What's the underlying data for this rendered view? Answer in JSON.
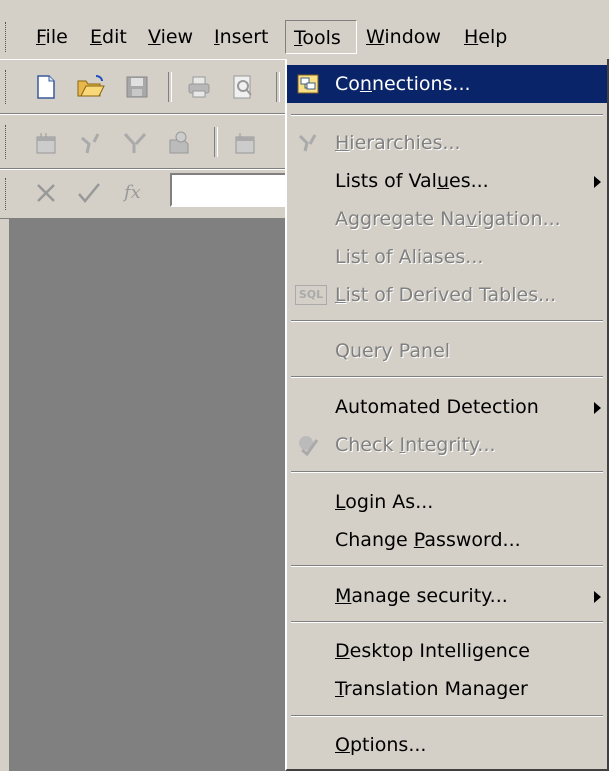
{
  "menubar": {
    "items": [
      {
        "label": "File",
        "key": "F",
        "rest": "ile"
      },
      {
        "label": "Edit",
        "key": "E",
        "rest": "dit"
      },
      {
        "label": "View",
        "key": "V",
        "rest": "iew"
      },
      {
        "label": "Insert",
        "key": "I",
        "rest": "nsert"
      },
      {
        "label": "Tools",
        "key": "T",
        "rest": "ools"
      },
      {
        "label": "Window",
        "key": "W",
        "rest": "indow"
      },
      {
        "label": "Help",
        "key": "H",
        "rest": "elp"
      }
    ]
  },
  "formula_bar": {
    "fx_label": "fx",
    "value": ""
  },
  "tools_menu": {
    "items": [
      {
        "label": "Connections...",
        "pre": "Co",
        "key": "n",
        "post": "nections...",
        "state": "highlighted",
        "icon": "connections-icon"
      },
      {
        "label": "Hierarchies...",
        "pre": "",
        "key": "H",
        "post": "ierarchies...",
        "state": "disabled",
        "icon": "hierarchies-icon"
      },
      {
        "label": "Lists of Values...",
        "pre": "Lists of Val",
        "key": "u",
        "post": "es...",
        "state": "enabled",
        "submenu": true
      },
      {
        "label": "Aggregate Navigation...",
        "pre": "Aggregate Na",
        "key": "v",
        "post": "igation...",
        "state": "disabled"
      },
      {
        "label": "List of Aliases...",
        "pre": "List of Aliases...",
        "key": "",
        "post": "",
        "state": "disabled"
      },
      {
        "label": "List of Derived Tables...",
        "pre": "",
        "key": "L",
        "post": "ist of Derived Tables...",
        "state": "disabled",
        "icon": "sql-icon",
        "icon_text": "SQL"
      },
      {
        "label": "Query Panel",
        "pre": "Query Panel",
        "key": "",
        "post": "",
        "state": "disabled"
      },
      {
        "label": "Automated Detection",
        "pre": "Automated Detection",
        "key": "",
        "post": "",
        "state": "enabled",
        "submenu": true
      },
      {
        "label": "Check Integrity...",
        "pre": "Check ",
        "key": "I",
        "post": "ntegrity...",
        "state": "disabled",
        "icon": "check-integrity-icon"
      },
      {
        "label": "Login As...",
        "pre": "",
        "key": "L",
        "post": "ogin As...",
        "state": "enabled"
      },
      {
        "label": "Change Password...",
        "pre": "Change ",
        "key": "P",
        "post": "assword...",
        "state": "enabled"
      },
      {
        "label": "Manage security...",
        "pre": "",
        "key": "M",
        "post": "anage security...",
        "state": "enabled",
        "submenu": true
      },
      {
        "label": "Desktop Intelligence",
        "pre": "",
        "key": "D",
        "post": "esktop Intelligence",
        "state": "enabled"
      },
      {
        "label": "Translation Manager",
        "pre": "",
        "key": "T",
        "post": "ranslation Manager",
        "state": "enabled"
      },
      {
        "label": "Options...",
        "pre": "",
        "key": "O",
        "post": "ptions...",
        "state": "enabled"
      }
    ]
  },
  "toolbar_icons": [
    "new-document-icon",
    "open-folder-icon",
    "save-icon",
    "print-icon",
    "print-preview-icon",
    "table-icon",
    "join-icon",
    "filter-icon",
    "context-icon",
    "new-table-icon",
    "x-cancel-icon",
    "check-icon"
  ],
  "colors": {
    "face": "#d4d0c8",
    "workspace": "#808080",
    "highlight": "#0a246a",
    "disabled_text": "#808080"
  }
}
